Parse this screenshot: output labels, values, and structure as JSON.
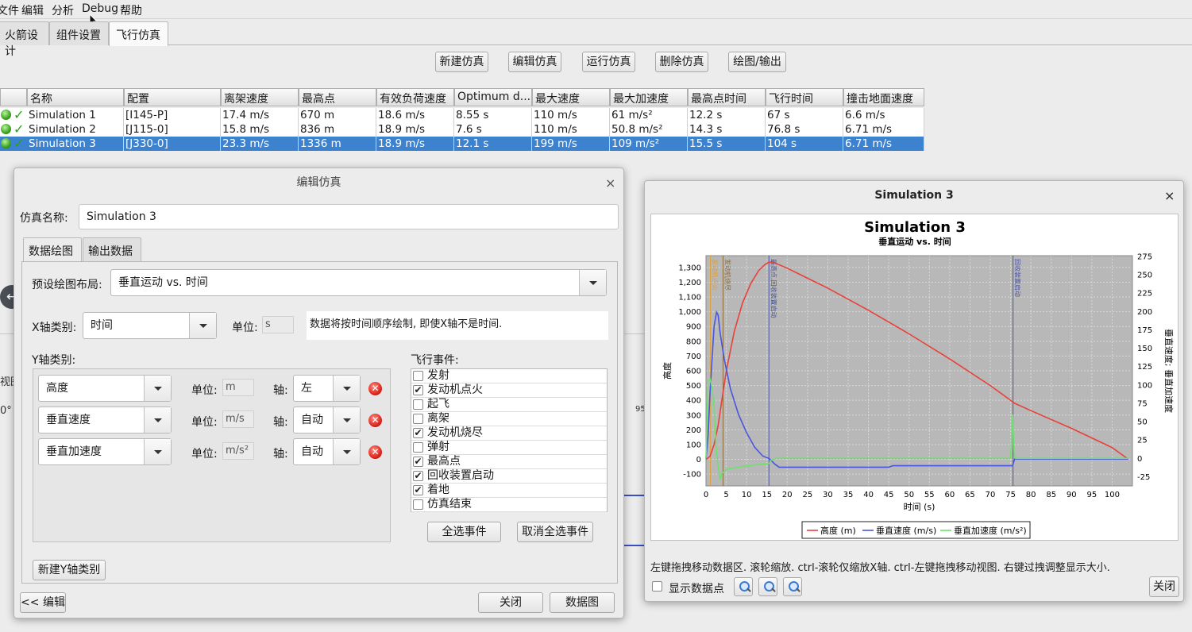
{
  "menu": {
    "items": [
      "文件",
      "编辑",
      "分析",
      "Debug",
      "帮助"
    ]
  },
  "main_tabs": [
    "火箭设计",
    "组件设置",
    "飞行仿真"
  ],
  "toolbar": {
    "new": "新建仿真",
    "edit": "编辑仿真",
    "run": "运行仿真",
    "delete": "删除仿真",
    "plot": "绘图/输出"
  },
  "table": {
    "headers": [
      "名称",
      "配置",
      "离架速度",
      "最高点",
      "有效负荷速度",
      "Optimum d...",
      "最大速度",
      "最大加速度",
      "最高点时间",
      "飞行时间",
      "撞击地面速度"
    ],
    "rows": [
      [
        "Simulation 1",
        "[I145-P]",
        "17.4 m/s",
        "670 m",
        "18.6 m/s",
        "8.55 s",
        "110 m/s",
        "61 m/s²",
        "12.2 s",
        "67 s",
        "6.6 m/s"
      ],
      [
        "Simulation 2",
        "[J115-0]",
        "15.8 m/s",
        "836 m",
        "18.9 m/s",
        "7.6 s",
        "110 m/s",
        "50.8 m/s²",
        "14.3 s",
        "76.8 s",
        "6.71 m/s"
      ],
      [
        "Simulation 3",
        "[J330-0]",
        "23.3 m/s",
        "1336 m",
        "18.9 m/s",
        "12.1 s",
        "199 m/s",
        "109 m/s²",
        "15.5 s",
        "104 s",
        "6.71 m/s"
      ]
    ],
    "selected_row": 2,
    "check_mark": "✓"
  },
  "background": {
    "left1": "视图",
    "left2": "0°",
    "scale_num": "95"
  },
  "edit_dialog": {
    "title": "编辑仿真",
    "close": "×",
    "name_label": "仿真名称:",
    "name_value": "Simulation 3",
    "tabs": [
      "数据绘图",
      "输出数据"
    ],
    "preset_label": "预设绘图布局:",
    "preset_value": "垂直运动 vs. 时间",
    "x_label": "X轴类别:",
    "x_value": "时间",
    "x_unit_label": "单位:",
    "x_unit": "s",
    "x_note": "数据将按时间顺序绘制, 即使X轴不是时间.",
    "y_label": "Y轴类别:",
    "y_rows": [
      {
        "type": "高度",
        "unit_label": "单位:",
        "unit": "m",
        "axis_label": "轴:",
        "axis": "左"
      },
      {
        "type": "垂直速度",
        "unit_label": "单位:",
        "unit": "m/s",
        "axis_label": "轴:",
        "axis": "自动"
      },
      {
        "type": "垂直加速度",
        "unit_label": "单位:",
        "unit": "m/s²",
        "axis_label": "轴:",
        "axis": "自动"
      }
    ],
    "remove_glyph": "✕",
    "events_label": "飞行事件:",
    "events": [
      {
        "name": "发射",
        "checked": false
      },
      {
        "name": "发动机点火",
        "checked": true
      },
      {
        "name": "起飞",
        "checked": false
      },
      {
        "name": "离架",
        "checked": false
      },
      {
        "name": "发动机烧尽",
        "checked": true
      },
      {
        "name": "弹射",
        "checked": false
      },
      {
        "name": "最高点",
        "checked": true
      },
      {
        "name": "回收装置启动",
        "checked": true
      },
      {
        "name": "着地",
        "checked": true
      },
      {
        "name": "仿真结束",
        "checked": false
      }
    ],
    "select_all": "全选事件",
    "deselect_all": "取消全选事件",
    "new_y": "新建Y轴类别",
    "back_edit": "<< 编辑",
    "close_btn": "关闭",
    "plot_btn": "数据图"
  },
  "plot_window": {
    "title": "Simulation 3",
    "close": "×",
    "hint": "左键拖拽移动数据区. 滚轮缩放. ctrl-滚轮仅缩放X轴. ctrl-左键拖拽移动视图. 右键过拽调整显示大小.",
    "show_points": "显示数据点",
    "close_btn": "关闭"
  },
  "chart_data": {
    "type": "line",
    "title": "Simulation 3",
    "subtitle": "垂直运动 vs. 时间",
    "xlabel": "时间 (s)",
    "ylabel_left": "高度",
    "ylabel_right": "垂直速度; 垂直加速度",
    "xlim": [
      0,
      105
    ],
    "xticks": [
      0,
      5,
      10,
      15,
      20,
      25,
      30,
      35,
      40,
      45,
      50,
      55,
      60,
      65,
      70,
      75,
      80,
      85,
      90,
      95,
      100
    ],
    "ylim_left": [
      -180,
      1380
    ],
    "yticks_left": [
      -100,
      0,
      100,
      200,
      300,
      400,
      500,
      600,
      700,
      800,
      900,
      1000,
      1100,
      1200,
      1300
    ],
    "ylim_right": [
      -37.5,
      276
    ],
    "yticks_right": [
      -25,
      0,
      25,
      50,
      75,
      100,
      125,
      150,
      175,
      200,
      225,
      250,
      275
    ],
    "grid": true,
    "legend_position": "bottom",
    "series": [
      {
        "name": "高度 (m)",
        "axis": "left",
        "color": "#e8413c",
        "x": [
          0,
          1,
          2,
          3,
          4,
          5,
          7,
          9,
          11,
          13,
          14.5,
          15.5,
          17,
          20,
          30,
          40,
          50,
          60,
          70,
          76,
          80,
          90,
          100,
          104
        ],
        "y": [
          0,
          20,
          100,
          230,
          420,
          600,
          870,
          1060,
          1190,
          1280,
          1320,
          1336,
          1330,
          1295,
          1160,
          1010,
          850,
          680,
          500,
          380,
          330,
          210,
          80,
          0
        ]
      },
      {
        "name": "垂直速度 (m/s)",
        "axis": "right",
        "color": "#4a55e0",
        "x": [
          0,
          0.5,
          1,
          2,
          2.6,
          3,
          3.5,
          4.5,
          6,
          8,
          10,
          12,
          14,
          15.5,
          17,
          18,
          20,
          30,
          45,
          46,
          60,
          75.5,
          76,
          78,
          104
        ],
        "y": [
          0,
          30,
          90,
          180,
          199,
          195,
          170,
          135,
          95,
          60,
          35,
          15,
          3,
          0,
          -8,
          -12,
          -12,
          -12,
          -12,
          -10,
          -10,
          -10,
          -1,
          -1,
          -1
        ]
      },
      {
        "name": "垂直加速度 (m/s²)",
        "axis": "right",
        "color": "#6ee06e",
        "x": [
          0,
          0.5,
          1,
          1.5,
          2,
          2.5,
          3,
          3.5,
          4,
          5,
          8,
          12,
          15.5,
          16,
          17,
          20,
          30,
          60,
          75,
          75.5,
          75.8,
          76.2,
          77,
          104
        ],
        "y": [
          0,
          105,
          109,
          95,
          70,
          15,
          -12,
          -28,
          -20,
          -15,
          -12,
          -9,
          -7,
          -3,
          0,
          0,
          0,
          0,
          0,
          60,
          10,
          0,
          0,
          0
        ]
      }
    ],
    "event_labels": [
      {
        "x": 1.1,
        "label": "发动机点火",
        "color": "#e0a030"
      },
      {
        "x": 4.2,
        "label": "发动机烧尽",
        "color": "#8a6a3a"
      },
      {
        "x": 15.5,
        "label": "最高点,回收装置启动",
        "color": "#4a55a0"
      },
      {
        "x": 75.6,
        "label": "回收装置启动",
        "color": "#4a55a0"
      }
    ],
    "legend": [
      "高度 (m)",
      "垂直速度 (m/s)",
      "垂直加速度 (m/s²)"
    ]
  }
}
